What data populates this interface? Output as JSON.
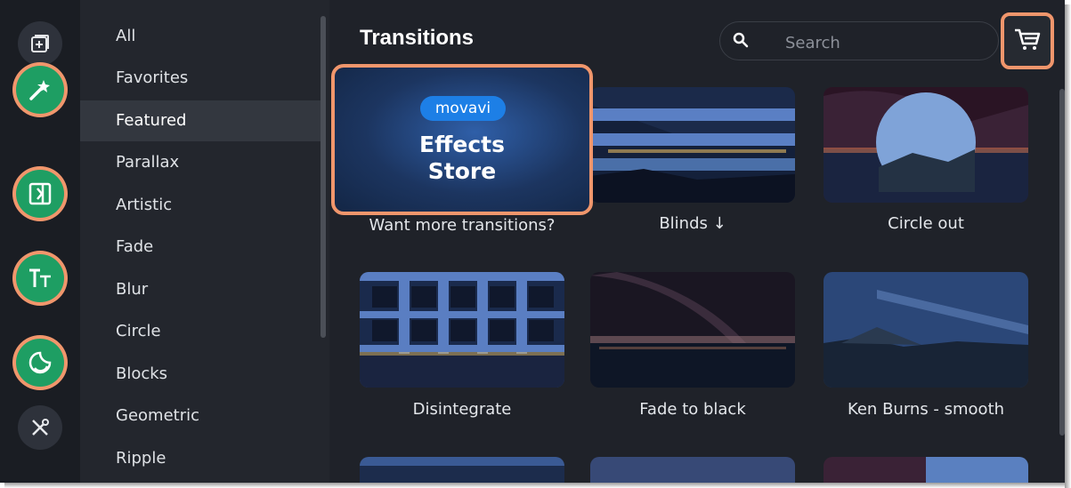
{
  "rail": {
    "items": [
      {
        "name": "import-icon",
        "style": "plain"
      },
      {
        "name": "magic-wand-icon",
        "style": "highlighted"
      },
      {
        "name": "transitions-icon",
        "style": "highlighted"
      },
      {
        "name": "titles-icon",
        "style": "highlighted"
      },
      {
        "name": "stickers-icon",
        "style": "highlighted"
      },
      {
        "name": "tools-icon",
        "style": "plain"
      }
    ],
    "highlight_color": "#f0966c",
    "active_color": "#1e9e63"
  },
  "categories": {
    "items": [
      "All",
      "Favorites",
      "Featured",
      "Parallax",
      "Artistic",
      "Fade",
      "Blur",
      "Circle",
      "Blocks",
      "Geometric",
      "Ripple"
    ],
    "selected": "Featured"
  },
  "header": {
    "title": "Transitions",
    "search_placeholder": "Search"
  },
  "store_card": {
    "badge": "movavi",
    "line1": "Effects",
    "line2": "Store",
    "caption": "Want more transitions?"
  },
  "transitions": [
    {
      "label": "Blinds ↓"
    },
    {
      "label": "Circle out"
    },
    {
      "label": "Disintegrate"
    },
    {
      "label": "Fade to black"
    },
    {
      "label": "Ken Burns - smooth"
    }
  ],
  "colors": {
    "accent": "#f0966c",
    "badge": "#1d7fe6",
    "background": "#1f2229"
  }
}
